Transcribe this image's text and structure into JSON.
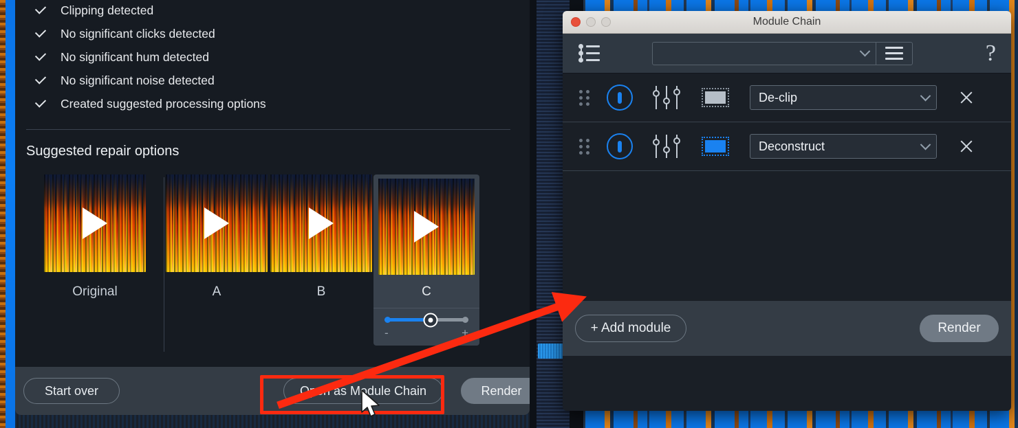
{
  "background": {
    "name": "spectrogram-editor-background"
  },
  "assistant": {
    "checklist": [
      "Clipping detected",
      "No significant clicks detected",
      "No significant hum detected",
      "No significant noise detected",
      "Created suggested processing options"
    ],
    "section_title": "Suggested repair options",
    "options": [
      {
        "label": "Original",
        "selected": false
      },
      {
        "label": "A",
        "selected": false
      },
      {
        "label": "B",
        "selected": false
      },
      {
        "label": "C",
        "selected": true
      }
    ],
    "intensity_slider": {
      "value_percent": 55,
      "minus_label": "-",
      "plus_label": "+"
    },
    "footer": {
      "start_over_label": "Start over",
      "open_as_module_chain_label": "Open as Module Chain",
      "render_label": "Render"
    }
  },
  "module_chain": {
    "window_title": "Module Chain",
    "traffic_lights": [
      "close",
      "minimize",
      "zoom"
    ],
    "toolbar": {
      "chain_list_icon": "chain-list-icon",
      "preset_value": "",
      "preset_placeholder": "",
      "menu_icon": "hamburger-menu-icon",
      "help_label": "?"
    },
    "modules": [
      {
        "grip": "drag-handle-icon",
        "power": "power-icon",
        "faders": "faders-icon",
        "box_state": "inactive",
        "name": "De-clip",
        "remove": "close-icon"
      },
      {
        "grip": "drag-handle-icon",
        "power": "power-icon",
        "faders": "faders-icon",
        "box_state": "active",
        "name": "Deconstruct",
        "remove": "close-icon"
      }
    ],
    "footer": {
      "add_module_label": "+ Add module",
      "render_label": "Render"
    }
  },
  "annotations": {
    "highlight_color": "#fc2a10",
    "arrow_color": "#fc2a10",
    "highlight_target": "open-as-module-chain-button",
    "arrow_from": "open-as-module-chain-button",
    "arrow_to": "module-chain-window",
    "cursor": "mouse-pointer"
  },
  "colors": {
    "accent_blue": "#1a82f0",
    "panel_dark": "#161b22",
    "footer_gray": "#343c45",
    "selection_blue": "#0b78ea",
    "spectro_orange": "#e2861b"
  }
}
